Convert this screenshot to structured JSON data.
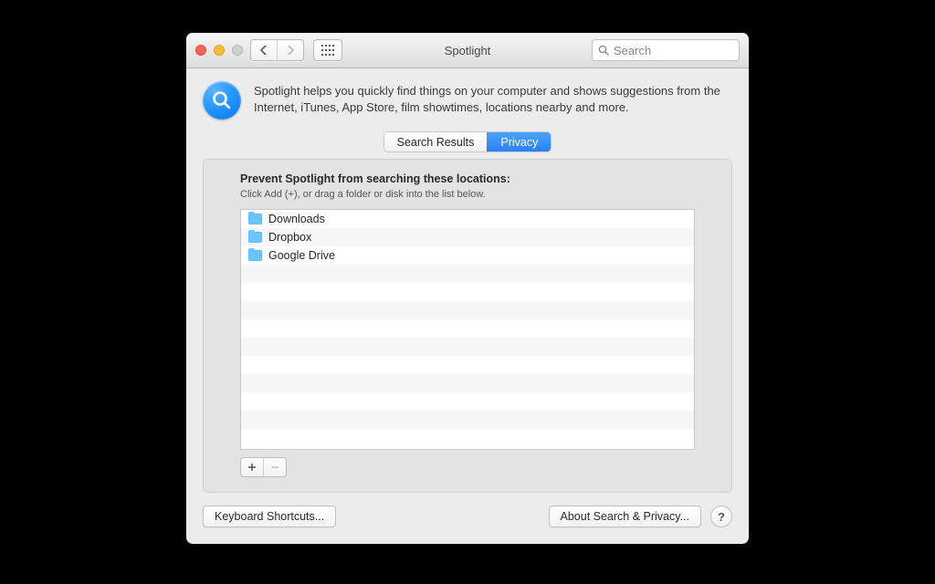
{
  "window": {
    "title": "Spotlight"
  },
  "search": {
    "placeholder": "Search"
  },
  "header": {
    "description": "Spotlight helps you quickly find things on your computer and shows suggestions from the Internet, iTunes, App Store, film showtimes, locations nearby and more."
  },
  "tabs": {
    "search_results": "Search Results",
    "privacy": "Privacy"
  },
  "privacy_panel": {
    "heading": "Prevent Spotlight from searching these locations:",
    "hint": "Click Add (+), or drag a folder or disk into the list below.",
    "locations": [
      {
        "name": "Downloads"
      },
      {
        "name": "Dropbox"
      },
      {
        "name": "Google Drive"
      }
    ]
  },
  "footer": {
    "keyboard_shortcuts": "Keyboard Shortcuts...",
    "about": "About Search & Privacy...",
    "help": "?"
  }
}
